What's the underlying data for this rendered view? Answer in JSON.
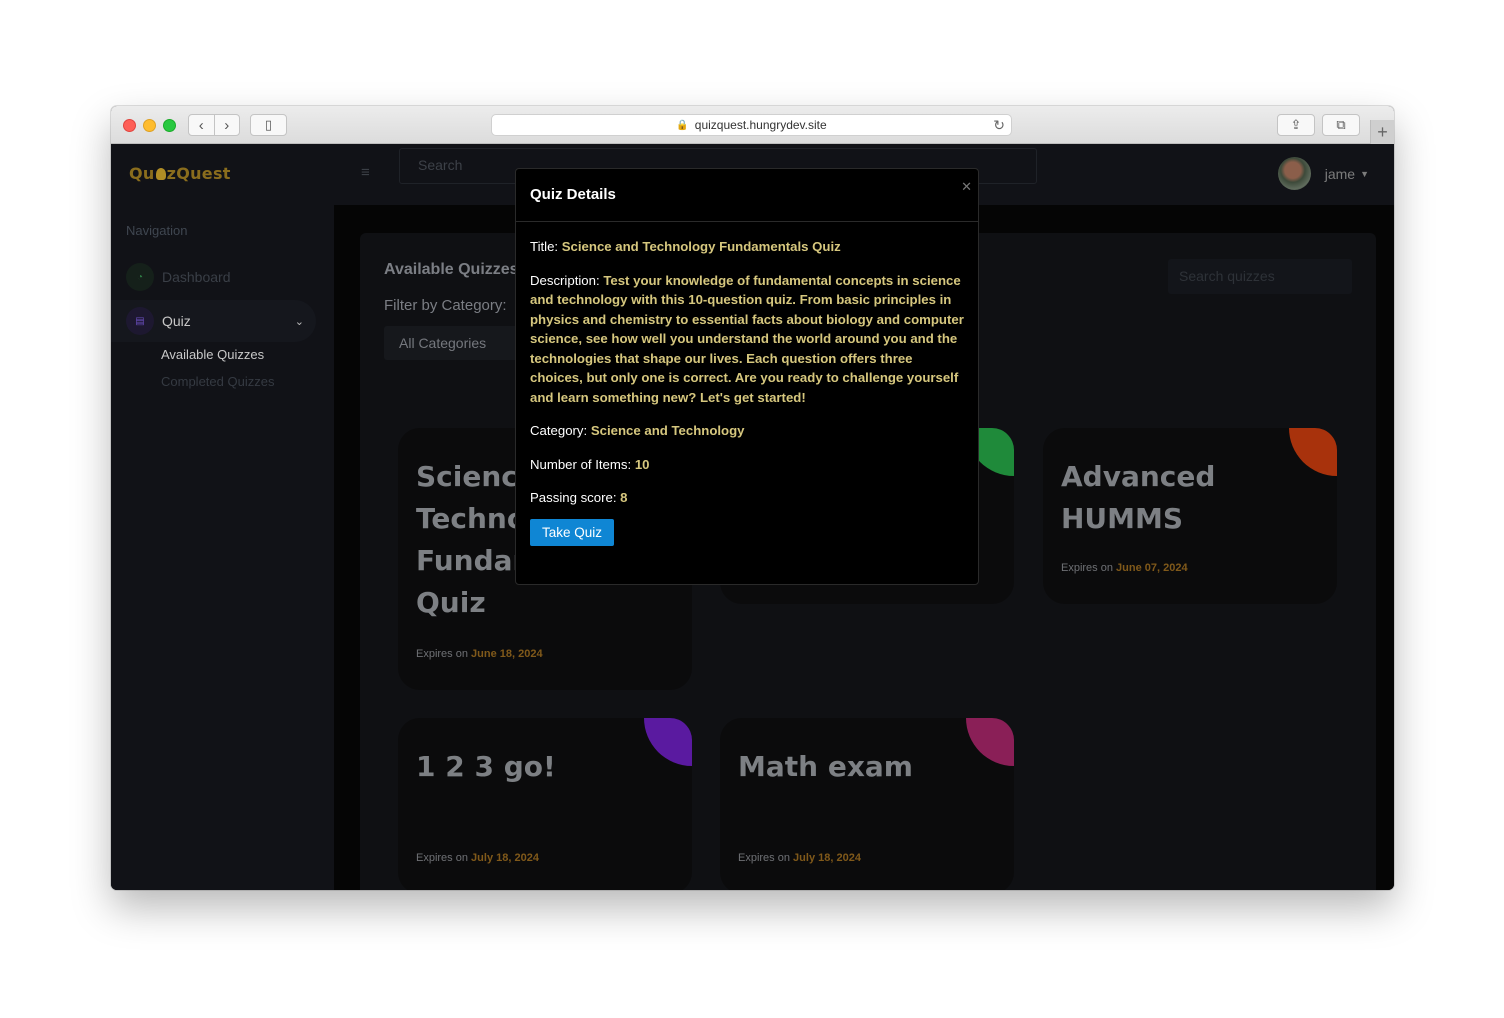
{
  "browser": {
    "url": "quizquest.hungrydev.site"
  },
  "app": {
    "logo": "QuizQuest",
    "logo_prefix": "Qu",
    "logo_suffix": "zQuest",
    "nav_title": "Navigation",
    "nav": [
      {
        "label": "Dashboard"
      },
      {
        "label": "Quiz"
      }
    ],
    "subnav": [
      {
        "label": "Available Quizzes"
      },
      {
        "label": "Completed Quizzes"
      }
    ],
    "search_placeholder": "Search",
    "user_name": "jame"
  },
  "main": {
    "title": "Available Quizzes",
    "filter_label": "Filter by Category:",
    "category_value": "All Categories",
    "search_placeholder": "Search quizzes",
    "expires_prefix": "Expires on",
    "cards": [
      {
        "title": "Science and Technology Fundamentals Quiz",
        "expires": "June 18, 2024",
        "accent": "#3a2a7a"
      },
      {
        "title": "",
        "expires": "",
        "accent": "#1f8a3a"
      },
      {
        "title": "Advanced HUMMS",
        "expires": "June 07, 2024",
        "accent": "#a8320c"
      },
      {
        "title": "1 2 3 go!",
        "expires": "July 18, 2024",
        "accent": "#5a1aa0"
      },
      {
        "title": "Math exam",
        "expires": "July 18, 2024",
        "accent": "#8a1f57"
      }
    ]
  },
  "modal": {
    "title": "Quiz Details",
    "title_label": "Title:",
    "title_value": "Science and Technology Fundamentals Quiz",
    "description_label": "Description:",
    "description_value": "Test your knowledge of fundamental concepts in science and technology with this 10-question quiz. From basic principles in physics and chemistry to essential facts about biology and computer science, see how well you understand the world around you and the technologies that shape our lives. Each question offers three choices, but only one is correct. Are you ready to challenge yourself and learn something new? Let's get started!",
    "category_label": "Category:",
    "category_value": "Science and Technology",
    "items_label": "Number of Items:",
    "items_value": "10",
    "passing_label": "Passing score:",
    "passing_value": "8",
    "button": "Take Quiz"
  },
  "colors": {
    "accent_blue": "#0f86d4",
    "highlight_text": "#d6c77e",
    "expires_date": "#80591a"
  }
}
